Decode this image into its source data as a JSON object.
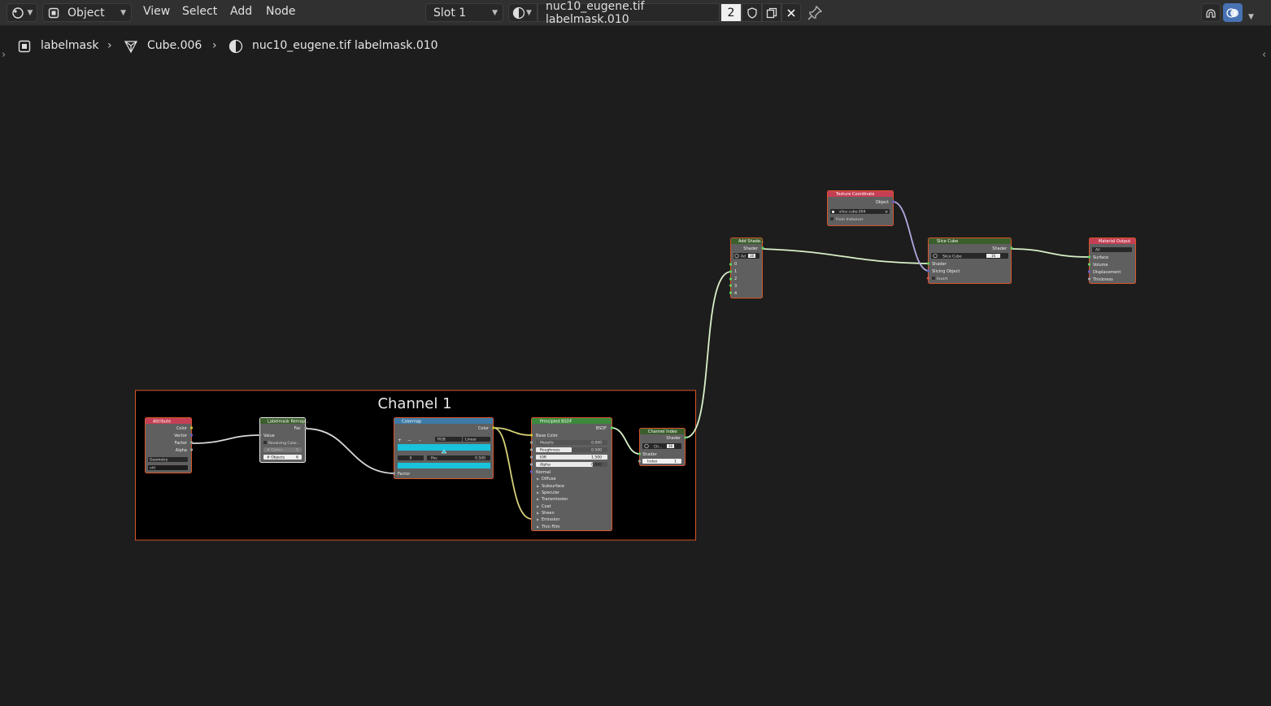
{
  "header": {
    "mode": "Object",
    "menus": [
      "View",
      "Select",
      "Add",
      "Node"
    ],
    "slot": "Slot 1",
    "material_name": "nuc10_eugene.tif labelmask.010",
    "user_count": "2"
  },
  "breadcrumb": {
    "object": "labelmask",
    "mesh": "Cube.006",
    "material": "nuc10_eugene.tif labelmask.010"
  },
  "frame": {
    "label": "Channel 1"
  },
  "nodes": {
    "attribute": {
      "title": "Attribute",
      "outputs": [
        "Color",
        "Vector",
        "Factor",
        "Alpha"
      ],
      "type_value": "Geometry",
      "name_value": "old"
    },
    "remap": {
      "title": "Labelmask Remap...",
      "output": "Fac",
      "input": "Value",
      "checkbox": "Revolving Color...",
      "colors_label": "# Colors",
      "colors_value": "5",
      "objects_label": "# Objects",
      "objects_value": "6"
    },
    "colormap": {
      "title": "Colormap",
      "output": "Color",
      "controls": [
        "+",
        "−",
        "–"
      ],
      "color_mode": "RGB",
      "interpolation": "Linear",
      "stop_index": "0",
      "pos_label": "Pos",
      "pos_value": "0.500",
      "input": "Factor"
    },
    "principled": {
      "title": "Principled BSDF",
      "output": "BSDF",
      "base_color": "Base Color",
      "metallic_label": "Metallic",
      "metallic_value": "0.000",
      "roughness_label": "Roughness",
      "roughness_value": "0.500",
      "ior_label": "IOR",
      "ior_value": "1.500",
      "alpha_label": "Alpha",
      "alpha_value": "0.800",
      "normal": "Normal",
      "panels": [
        "Diffuse",
        "Subsurface",
        "Specular",
        "Transmission",
        "Coat",
        "Sheen",
        "Emission",
        "Thin Film"
      ]
    },
    "channel_index": {
      "title": "Channel Index",
      "output": "Shader",
      "group": "Ch...",
      "group_users": "16",
      "input": "Shader",
      "index_label": "Index",
      "index_value": "1"
    },
    "add_shader": {
      "title": "Add Shade...",
      "output": "Shader",
      "group": "Ad",
      "group_users": "16",
      "inputs": [
        "0",
        "1",
        "2",
        "3",
        "4"
      ]
    },
    "texture_coordinate": {
      "title": "Texture Coordinate",
      "output": "Object",
      "object_value": "slice cube.004",
      "checkbox": "From Instancer"
    },
    "slice_cube": {
      "title": "Slice Cube",
      "output": "Shader",
      "group": "Slice Cube",
      "group_users": "16",
      "inputs": [
        "Shader",
        "Slicing Object"
      ],
      "checkbox": "Invert"
    },
    "material_output": {
      "title": "Material Output",
      "target": "All",
      "inputs": [
        "Surface",
        "Volume",
        "Displacement",
        "Thickness"
      ]
    }
  },
  "colors": {
    "header_bg": "#303030",
    "canvas_bg": "#1d1d1d",
    "frame_border": "#d8542a",
    "node_body": "#5f5f5f",
    "attribute_header": "#c53f54",
    "group_header": "#3b5f2c",
    "colormap_header": "#3c7aa8",
    "principled_header": "#3c8a3c",
    "texture_header": "#c53f54",
    "output_header": "#c53f54",
    "link_color": "#d8f0c8",
    "color_link": "#d6d27a",
    "socket_yellow": "#c7c729",
    "socket_green": "#5fd35f",
    "socket_grey": "#a1a1a1",
    "socket_purple": "#6363c7",
    "ramp_cyan": "#19c3dc",
    "accent_blue": "#4772b3"
  }
}
